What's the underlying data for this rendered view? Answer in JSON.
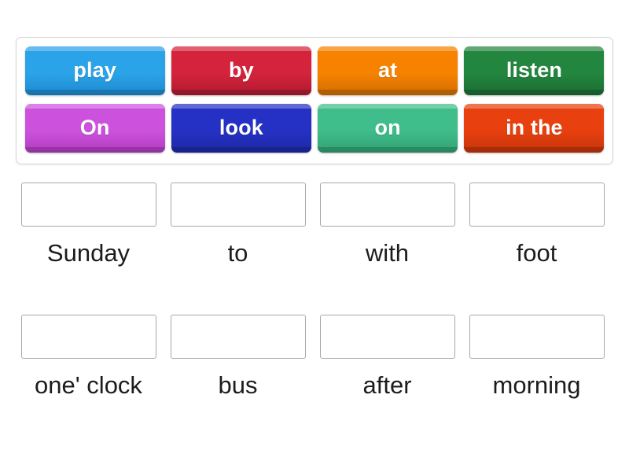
{
  "activity": {
    "type": "drag-and-drop-word-match",
    "tray": {
      "rows": [
        [
          {
            "label": "play",
            "color": "#2ba3e8",
            "color_dark": "#1d8ad0"
          },
          {
            "label": "by",
            "color": "#d5233c",
            "color_dark": "#b01a30"
          },
          {
            "label": "at",
            "color": "#f78200",
            "color_dark": "#d26e00"
          },
          {
            "label": "listen",
            "color": "#23863f",
            "color_dark": "#1b6d33"
          }
        ],
        [
          {
            "label": "On",
            "color": "#cc52dd",
            "color_dark": "#b13cc0"
          },
          {
            "label": "look",
            "color": "#2531c4",
            "color_dark": "#1d28a4"
          },
          {
            "label": "on",
            "color": "#3fbd8a",
            "color_dark": "#32a073"
          },
          {
            "label": "in the",
            "color": "#e8400f",
            "color_dark": "#c5350c"
          }
        ]
      ]
    },
    "answers": {
      "rows": [
        [
          {
            "text": "Sunday",
            "drop_value": ""
          },
          {
            "text": "to",
            "drop_value": ""
          },
          {
            "text": "with",
            "drop_value": ""
          },
          {
            "text": "foot",
            "drop_value": ""
          }
        ],
        [
          {
            "text": "one' clock",
            "drop_value": ""
          },
          {
            "text": "bus",
            "drop_value": ""
          },
          {
            "text": "after",
            "drop_value": ""
          },
          {
            "text": "morning",
            "drop_value": ""
          }
        ]
      ]
    }
  }
}
